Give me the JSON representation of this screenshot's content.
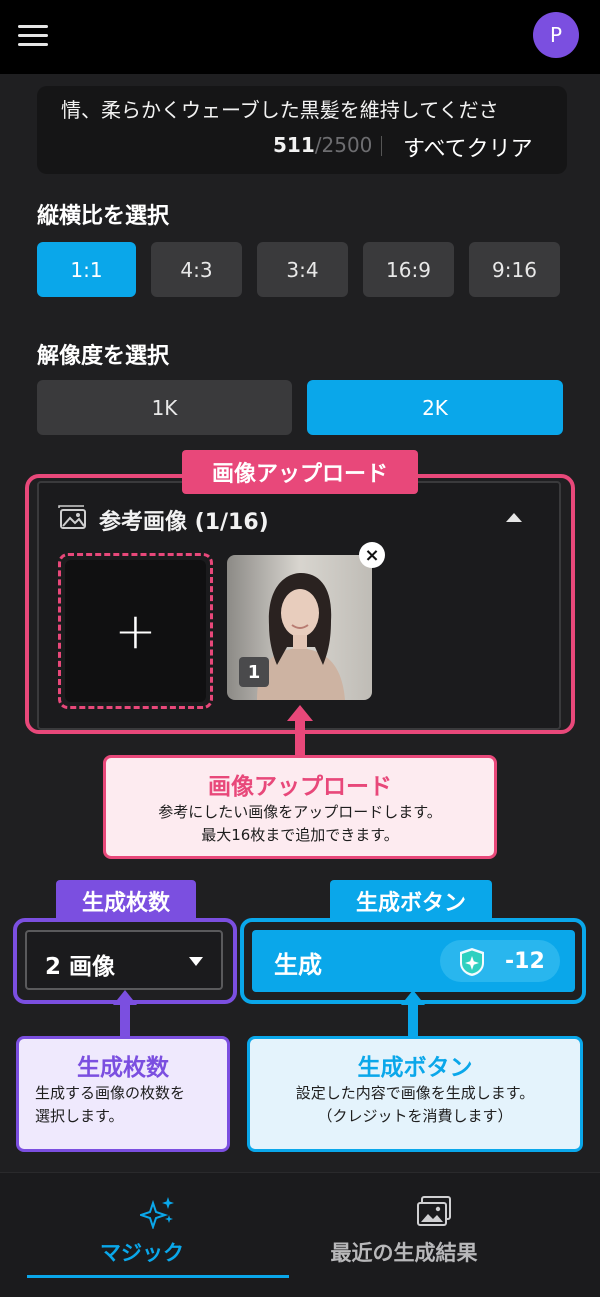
{
  "header": {
    "avatar_initial": "P"
  },
  "prompt": {
    "text": "情、柔らかくウェーブした黒髪を維持してくださ",
    "char_count": "511",
    "char_max": "/2500",
    "clear_all_label": "すべてクリア"
  },
  "aspect_ratio": {
    "label": "縦横比を選択",
    "options": [
      "1:1",
      "4:3",
      "3:4",
      "16:9",
      "9:16"
    ],
    "selected": "1:1"
  },
  "resolution": {
    "label": "解像度を選択",
    "options": [
      "1K",
      "2K"
    ],
    "selected": "2K"
  },
  "reference_images": {
    "tag_label": "画像アップロード",
    "title": "参考画像 (1/16)",
    "add_symbol": "+",
    "thumbnails": [
      {
        "badge": "1"
      }
    ],
    "remove_symbol": "×"
  },
  "callouts": {
    "upload": {
      "title": "画像アップロード",
      "line1": "参考にしたい画像をアップロードします。",
      "line2": "最大16枚まで追加できます。"
    },
    "count": {
      "tag": "生成枚数",
      "title": "生成枚数",
      "line1": "生成する画像の枚数を",
      "line2": "選択します。"
    },
    "generate": {
      "tag": "生成ボタン",
      "title": "生成ボタン",
      "line1": "設定した内容で画像を生成します。",
      "line2": "（クレジットを消費します）"
    }
  },
  "generation": {
    "count_value": "2 画像",
    "generate_label": "生成",
    "credit_cost": "-12"
  },
  "bottom_nav": {
    "items": [
      {
        "label": "マジック",
        "icon": "sparkle-icon",
        "active": true
      },
      {
        "label": "最近の生成結果",
        "icon": "gallery-icon",
        "active": false
      }
    ]
  },
  "colors": {
    "accent_blue": "#0aa7ea",
    "accent_pink": "#e8487a",
    "accent_purple": "#7b4fe0",
    "background": "#1f1f21"
  }
}
